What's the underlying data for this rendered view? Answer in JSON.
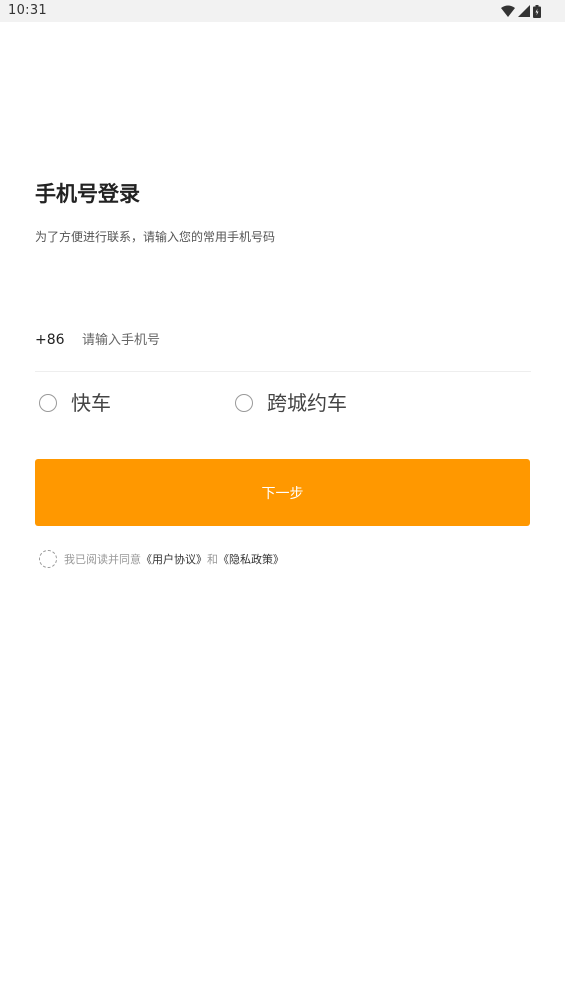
{
  "status_bar": {
    "time": "10:31",
    "icons": [
      "wifi-icon",
      "signal-icon",
      "battery-icon"
    ]
  },
  "login": {
    "title": "手机号登录",
    "subtitle": "为了方便进行联系，请输入您的常用手机号码",
    "country_code": "+86",
    "phone_placeholder": "请输入手机号",
    "phone_value": ""
  },
  "ride_types": [
    {
      "label": "快车",
      "selected": false
    },
    {
      "label": "跨城约车",
      "selected": false
    }
  ],
  "next_button": {
    "label": "下一步",
    "color": "#ff9800"
  },
  "agreement": {
    "checked": false,
    "prefix": "我已阅读并同意",
    "user_agreement": "《用户协议》",
    "conjunction": "和",
    "privacy_policy": "《隐私政策》"
  }
}
